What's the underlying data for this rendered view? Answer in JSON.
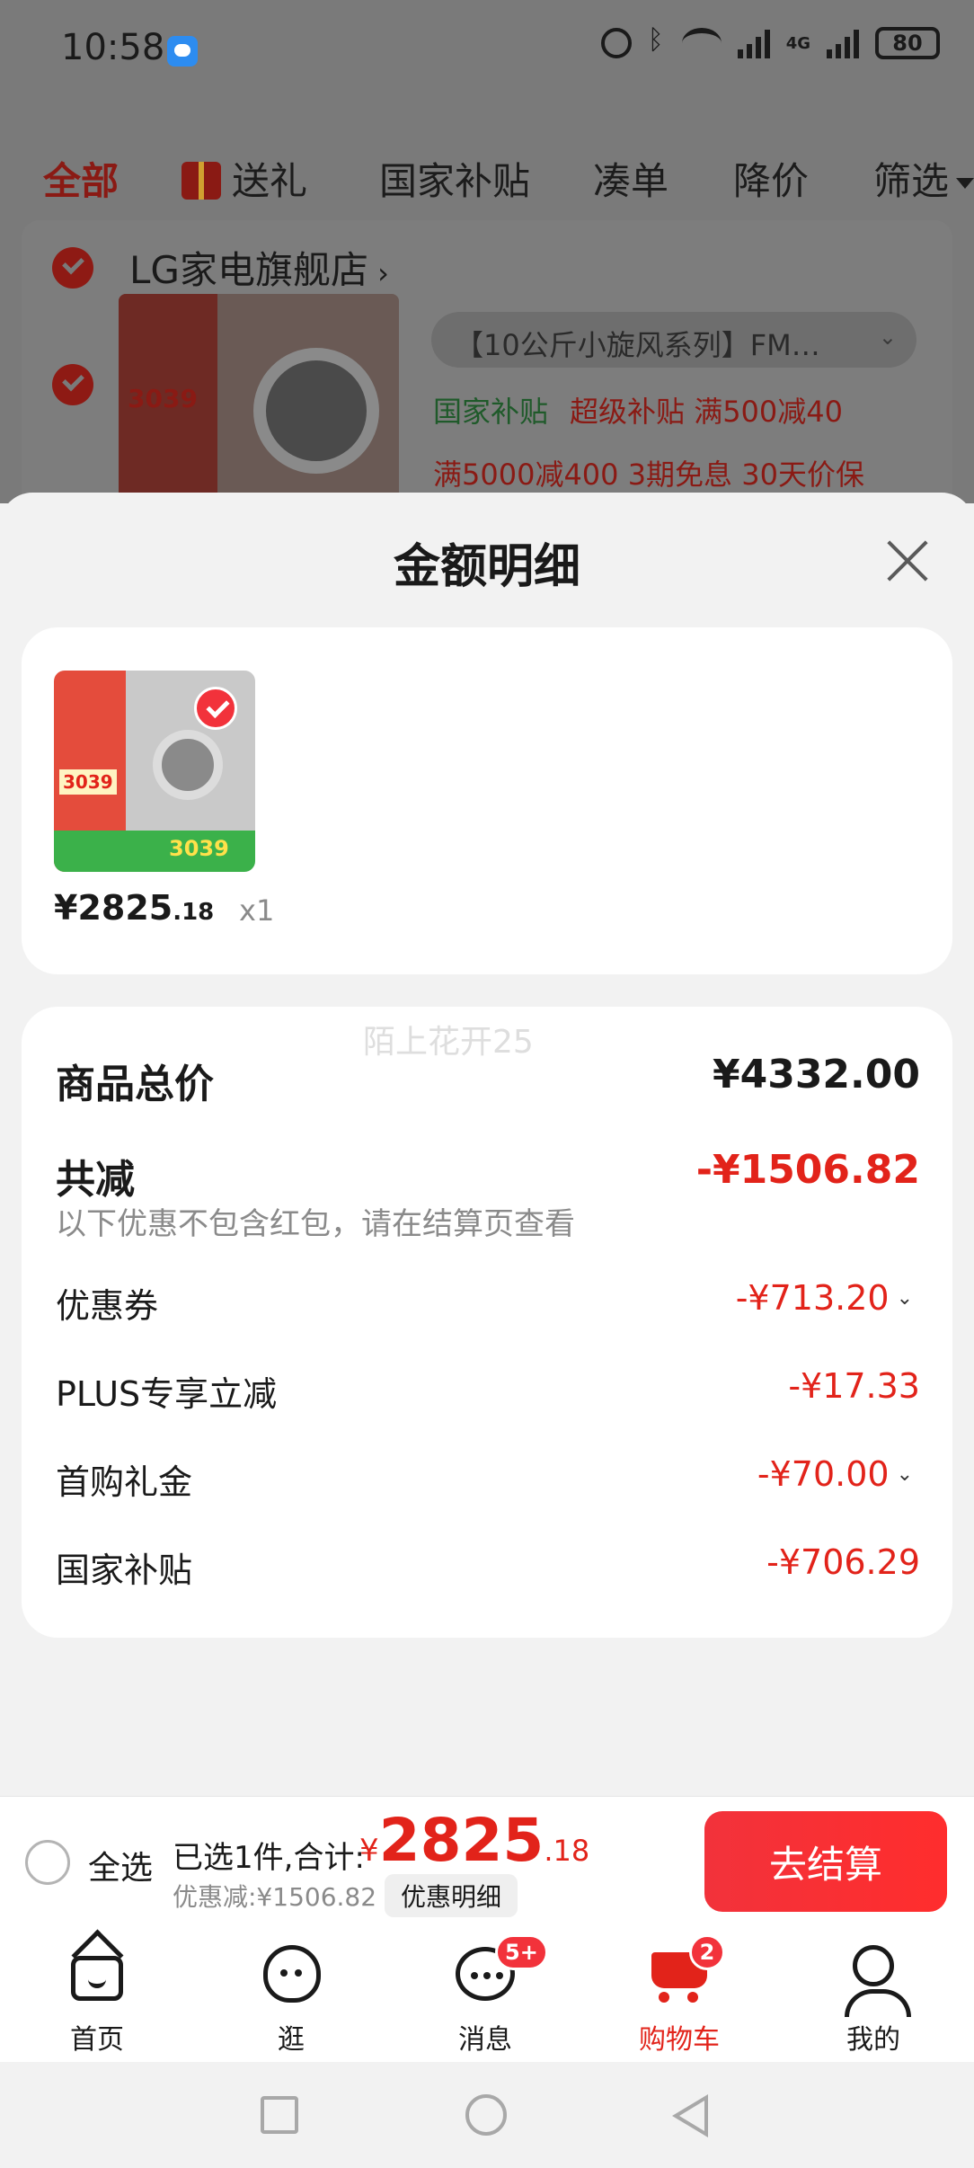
{
  "status_bar": {
    "time": "10:58",
    "network": "4G",
    "battery": "80"
  },
  "tabs": [
    {
      "label": "全部"
    },
    {
      "label": "送礼"
    },
    {
      "label": "国家补贴"
    },
    {
      "label": "凑单"
    },
    {
      "label": "降价"
    },
    {
      "label": "筛选"
    }
  ],
  "store": {
    "name": "LG家电旗舰店",
    "item": {
      "variant": "【10公斤小旋风系列】FM…",
      "tag_green": "国家补贴",
      "tag_red": "超级补贴 满500减40",
      "promo_line": "满5000减400  3期免息  30天价保",
      "thumb_price": "3039"
    }
  },
  "sheet": {
    "title": "金额明细",
    "product": {
      "price_symbol": "¥",
      "price_int": "2825",
      "price_dec": ".18",
      "qty": "x1",
      "thumb_price": "3039",
      "thumb_price_strip": "3039"
    },
    "watermark": "陌上花开25",
    "rows": {
      "total": {
        "label": "商品总价",
        "value": "¥4332.00"
      },
      "reduce": {
        "label": "共减",
        "value": "-¥1506.82",
        "note": "以下优惠不包含红包，请在结算页查看"
      },
      "coupon": {
        "label": "优惠券",
        "value": "-¥713.20"
      },
      "plus": {
        "label": "PLUS专享立减",
        "value": "-¥17.33"
      },
      "first": {
        "label": "首购礼金",
        "value": "-¥70.00"
      },
      "subsidy": {
        "label": "国家补贴",
        "value": "-¥706.29"
      }
    }
  },
  "checkout": {
    "select_all": "全选",
    "summary": "已选1件,合计:",
    "currency": "¥",
    "total_int": "2825",
    "total_dec": ".18",
    "discount": "优惠减:¥1506.82",
    "detail_btn": "优惠明细",
    "pay_btn": "去结算"
  },
  "bottom_nav": [
    {
      "label": "首页"
    },
    {
      "label": "逛"
    },
    {
      "label": "消息",
      "badge": "5+"
    },
    {
      "label": "购物车",
      "badge": "2"
    },
    {
      "label": "我的"
    }
  ],
  "colors": {
    "accent": "#e2231a",
    "button": "#f2323b",
    "green": "#3bb14a"
  }
}
